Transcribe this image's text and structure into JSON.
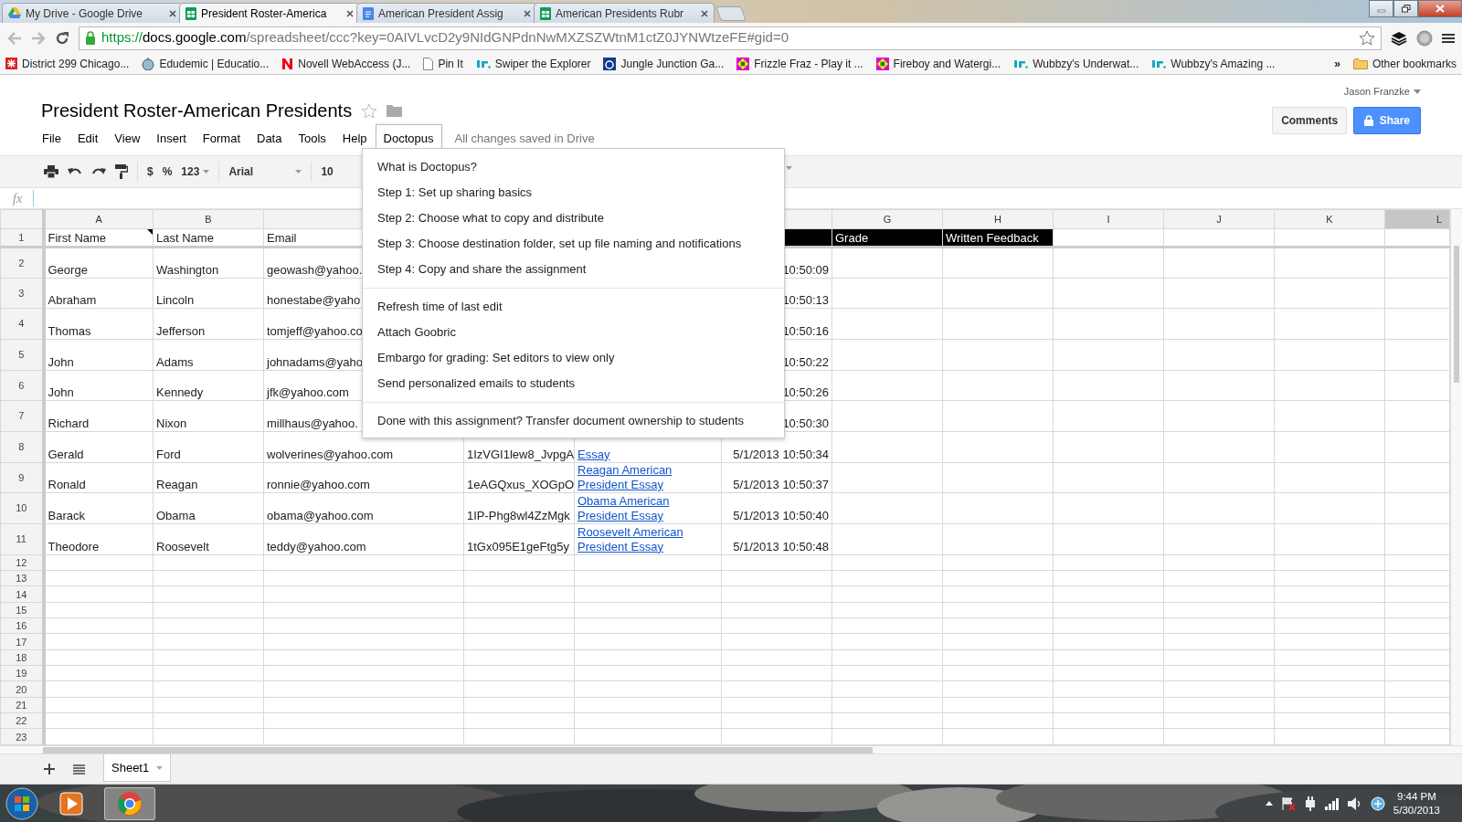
{
  "browser": {
    "tabs": [
      {
        "title": "My Drive - Google Drive",
        "kind": "drive",
        "selected": false
      },
      {
        "title": "President Roster-America",
        "kind": "sheet",
        "selected": true
      },
      {
        "title": "American President Assig",
        "kind": "doc",
        "selected": false
      },
      {
        "title": "American Presidents Rubr",
        "kind": "sheet",
        "selected": false
      }
    ],
    "url": {
      "scheme": "https://",
      "host": "docs.google.com",
      "path": "/spreadsheet/ccc?key=0AIVLvcD2y9NIdGNPdnNwMXZSZWtnM1ctZ0JYNWtzeFE#gid=0"
    },
    "bookmarks": [
      {
        "label": "District 299 Chicago...",
        "kind": "red"
      },
      {
        "label": "Edudemic | Educatio...",
        "kind": "apple"
      },
      {
        "label": "Novell WebAccess (J...",
        "kind": "novell"
      },
      {
        "label": "Pin It",
        "kind": "page"
      },
      {
        "label": "Swiper the Explorer",
        "kind": "jr"
      },
      {
        "label": "Jungle Junction Ga...",
        "kind": "disney"
      },
      {
        "label": "Frizzle Fraz - Play it ...",
        "kind": "diamond"
      },
      {
        "label": "Fireboy and Watergi...",
        "kind": "diamond"
      },
      {
        "label": "Wubbzy's Underwat...",
        "kind": "jr"
      },
      {
        "label": "Wubbzy's Amazing ...",
        "kind": "jr"
      }
    ],
    "overflow": "»",
    "other_bookmarks": "Other bookmarks"
  },
  "doc": {
    "title": "President Roster-American Presidents",
    "user": "Jason Franzke",
    "comments": "Comments",
    "share": "Share",
    "menus": [
      {
        "label": "File",
        "selected": false
      },
      {
        "label": "Edit",
        "selected": false
      },
      {
        "label": "View",
        "selected": false
      },
      {
        "label": "Insert",
        "selected": false
      },
      {
        "label": "Format",
        "selected": false
      },
      {
        "label": "Data",
        "selected": false
      },
      {
        "label": "Tools",
        "selected": false
      },
      {
        "label": "Help",
        "selected": false
      },
      {
        "label": "Doctopus",
        "selected": true
      }
    ],
    "save_status": "All changes saved in Drive"
  },
  "toolbar": {
    "currency": "$",
    "percent": "%",
    "number_format": "123",
    "font": "Arial",
    "font_size": "10"
  },
  "formula_bar": {
    "label": "fx"
  },
  "sheet": {
    "columns": [
      {
        "label": "A",
        "selected": false
      },
      {
        "label": "B",
        "selected": false
      },
      {
        "label": "G",
        "selected": false
      },
      {
        "label": "H",
        "selected": false
      },
      {
        "label": "I",
        "selected": false
      },
      {
        "label": "J",
        "selected": false
      },
      {
        "label": "K",
        "selected": false
      },
      {
        "label": "L",
        "selected": true
      }
    ],
    "header_row": {
      "number": "1",
      "cells": {
        "first_name": {
          "text": "First Name",
          "note": true
        },
        "last_name": {
          "text": "Last Name"
        },
        "email": {
          "text": "Email"
        },
        "timestamp": {
          "kind": "dark"
        },
        "grade": {
          "text": "Grade",
          "kind": "dark"
        },
        "feedback": {
          "text": "Written Feedback",
          "kind": "dark"
        }
      }
    },
    "rows": [
      {
        "number": "2",
        "cells": {
          "first_name": "George",
          "last_name": "Washington",
          "email": "geowash@yahoo.",
          "timestamp": "10:50:09"
        }
      },
      {
        "number": "3",
        "cells": {
          "first_name": "Abraham",
          "last_name": "Lincoln",
          "email": "honestabe@yaho",
          "timestamp": "10:50:13"
        }
      },
      {
        "number": "4",
        "cells": {
          "first_name": "Thomas",
          "last_name": "Jefferson",
          "email": "tomjeff@yahoo.co",
          "timestamp": "10:50:16"
        }
      },
      {
        "number": "5",
        "cells": {
          "first_name": "John",
          "last_name": "Adams",
          "email": "johnadams@yaho",
          "timestamp": "10:50:22"
        }
      },
      {
        "number": "6",
        "cells": {
          "first_name": "John",
          "last_name": "Kennedy",
          "email": "jfk@yahoo.com",
          "timestamp": "10:50:26"
        }
      },
      {
        "number": "7",
        "cells": {
          "first_name": "Richard",
          "last_name": "Nixon",
          "email": "millhaus@yahoo.",
          "timestamp": "10:50:30"
        }
      },
      {
        "number": "8",
        "cells": {
          "first_name": "Gerald",
          "last_name": "Ford",
          "email": "wolverines@yahoo.com",
          "file_id": "1IzVGI1lew8_JvpgA",
          "link": {
            "text": "Essay",
            "kind": "link"
          },
          "timestamp": "5/1/2013 10:50:34"
        }
      },
      {
        "number": "9",
        "cells": {
          "first_name": "Ronald",
          "last_name": "Reagan",
          "email": "ronnie@yahoo.com",
          "file_id": "1eAGQxus_XOGpO",
          "link": {
            "text": "Reagan American President Essay",
            "kind": "link"
          },
          "timestamp": "5/1/2013 10:50:37"
        }
      },
      {
        "number": "10",
        "cells": {
          "first_name": "Barack",
          "last_name": "Obama",
          "email": "obama@yahoo.com",
          "file_id": "1IP-Phg8wl4ZzMgk",
          "link": {
            "text": "Obama American President Essay",
            "kind": "link"
          },
          "timestamp": "5/1/2013 10:50:40"
        }
      },
      {
        "number": "11",
        "cells": {
          "first_name": "Theodore",
          "last_name": "Roosevelt",
          "email": "teddy@yahoo.com",
          "file_id": "1tGx095E1geFtg5y",
          "link": {
            "text": "Roosevelt American President Essay",
            "kind": "link"
          },
          "timestamp": "5/1/2013 10:50:48"
        }
      }
    ],
    "empty_rows": [
      "12",
      "13",
      "14",
      "15",
      "16",
      "17",
      "18",
      "19",
      "20",
      "21",
      "22",
      "23"
    ]
  },
  "menu": {
    "groups": [
      [
        "What is Doctopus?",
        "Step 1: Set up sharing basics",
        "Step 2: Choose what to copy and distribute",
        "Step 3: Choose destination folder, set up file naming and notifications",
        "Step 4: Copy and share the assignment"
      ],
      [
        "Refresh time of last edit",
        "Attach Goobric",
        "Embargo for grading: Set editors to view only",
        "Send personalized emails to students"
      ],
      [
        "Done with this assignment? Transfer document ownership to students"
      ]
    ]
  },
  "sheet_tabs": [
    {
      "label": "Sheet1",
      "selected": true
    }
  ],
  "taskbar": {
    "time": "9:44 PM",
    "date": "5/30/2013"
  }
}
